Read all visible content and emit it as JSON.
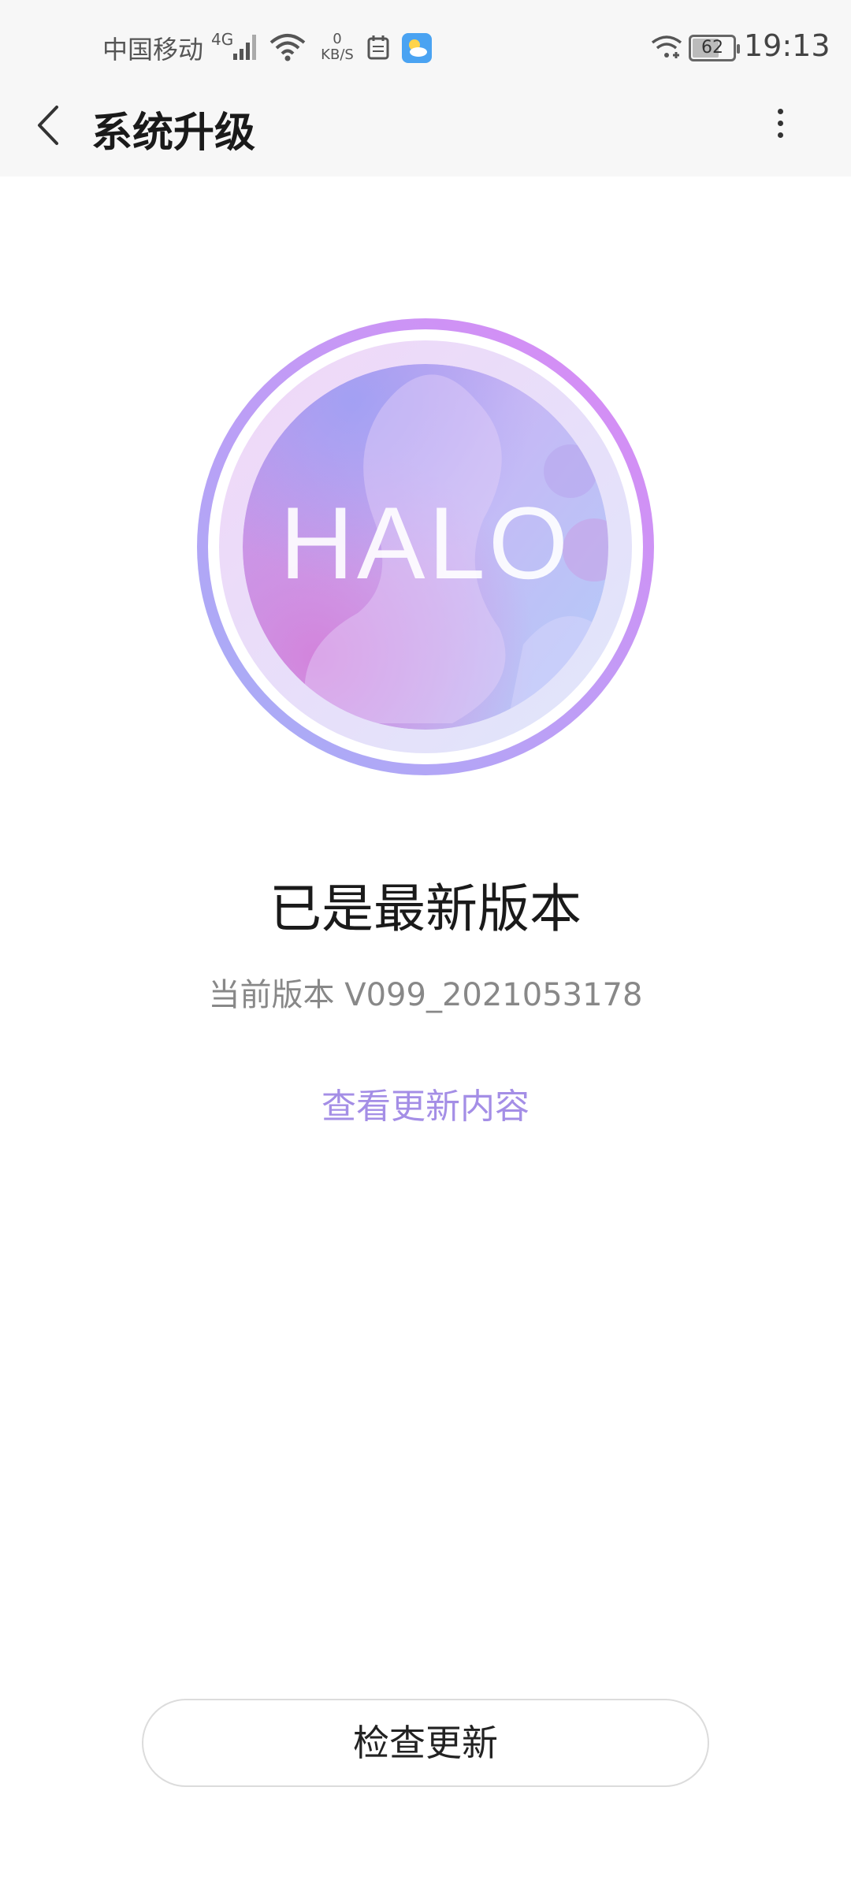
{
  "status_bar": {
    "carrier": "中国移动",
    "network_type": "4G",
    "speed_value": "0",
    "speed_unit": "KB/S",
    "battery_level": "62",
    "time": "19:13"
  },
  "header": {
    "title": "系统升级",
    "back_icon": "chevron-left-icon",
    "more_icon": "more-vertical-icon"
  },
  "logo": {
    "text": "HALO"
  },
  "main": {
    "status_title": "已是最新版本",
    "current_version": "当前版本 V099_2021053178",
    "changelog_link": "查看更新内容"
  },
  "footer": {
    "check_update_label": "检查更新"
  },
  "colors": {
    "accent": "#a48ee6",
    "ring_top": "#d88bf4",
    "ring_bottom": "#a7b0f5"
  }
}
